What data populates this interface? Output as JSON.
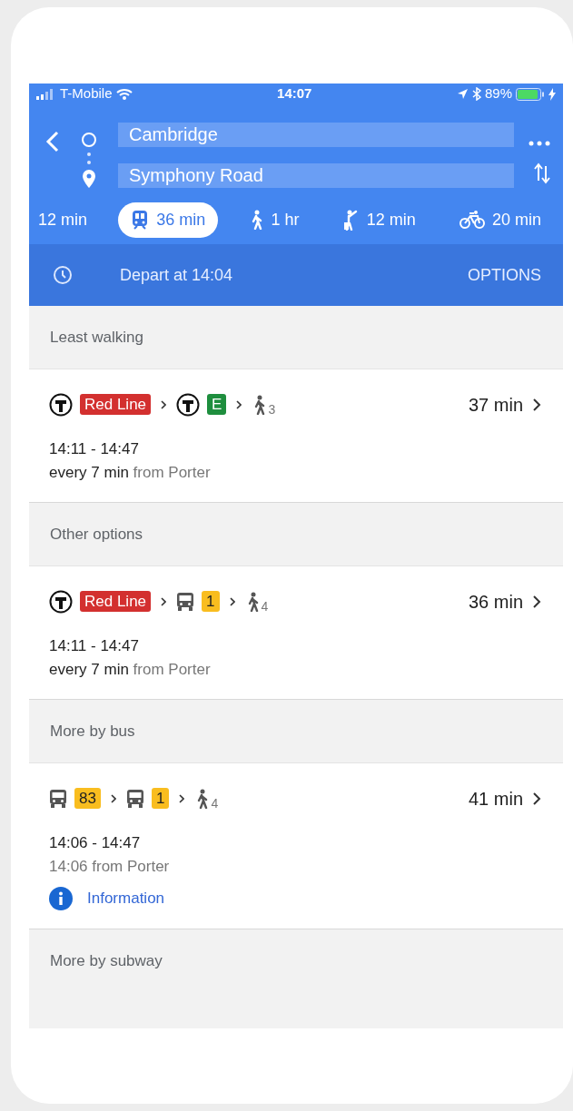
{
  "status_bar": {
    "carrier": "T-Mobile",
    "time": "14:07",
    "battery": "89%"
  },
  "route": {
    "origin": "Cambridge",
    "destination": "Symphony Road"
  },
  "modes": [
    {
      "kind": "drive",
      "label": "12 min",
      "selected": false
    },
    {
      "kind": "transit",
      "label": "36 min",
      "selected": true
    },
    {
      "kind": "walk",
      "label": "1 hr",
      "selected": false
    },
    {
      "kind": "rideshare",
      "label": "12 min",
      "selected": false
    },
    {
      "kind": "bike",
      "label": "20 min",
      "selected": false
    }
  ],
  "depart": {
    "label": "Depart at 14:04",
    "options": "OPTIONS"
  },
  "sections": [
    {
      "title": "Least walking",
      "routes": [
        {
          "steps": [
            {
              "kind": "subway",
              "line": "Red Line",
              "color": "#d3302f"
            },
            {
              "kind": "subway",
              "line": "E",
              "color": "#1e8e3e"
            },
            {
              "kind": "walk",
              "count": "3"
            }
          ],
          "duration": "37 min",
          "times": "14:11 - 14:47",
          "frequency": "every 7 min",
          "origin": "from Porter"
        }
      ]
    },
    {
      "title": "Other options",
      "routes": [
        {
          "steps": [
            {
              "kind": "subway",
              "line": "Red Line",
              "color": "#d3302f"
            },
            {
              "kind": "bus",
              "line": "1",
              "color": "#f9bd1f"
            },
            {
              "kind": "walk",
              "count": "4"
            }
          ],
          "duration": "36 min",
          "times": "14:11 - 14:47",
          "frequency": "every 7 min",
          "origin": "from Porter"
        }
      ]
    },
    {
      "title": "More by bus",
      "routes": [
        {
          "steps": [
            {
              "kind": "bus",
              "line": "83",
              "color": "#f9bd1f"
            },
            {
              "kind": "bus",
              "line": "1",
              "color": "#f9bd1f"
            },
            {
              "kind": "walk",
              "count": "4"
            }
          ],
          "duration": "41 min",
          "times": "14:06 - 14:47",
          "origin": "14:06 from Porter",
          "info": "Information"
        }
      ]
    },
    {
      "title": "More by subway"
    }
  ]
}
